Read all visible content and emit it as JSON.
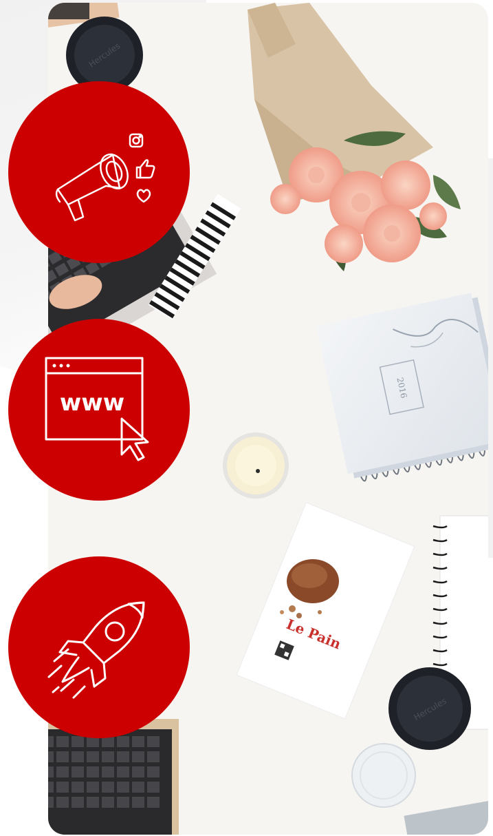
{
  "colors": {
    "accent": "#cc0000",
    "background": "#ffffff",
    "desk": "#f7f5f2"
  },
  "photo": {
    "alt_label": "flat-lay desk with laptops, flowers, notebooks, candle and coffee cups",
    "calendar_year": "2016",
    "bag_brand": "Le Pain"
  },
  "features": [
    {
      "icon": "megaphone-social-icon"
    },
    {
      "icon": "website-www-cursor-icon"
    },
    {
      "icon": "rocket-launch-icon"
    }
  ]
}
